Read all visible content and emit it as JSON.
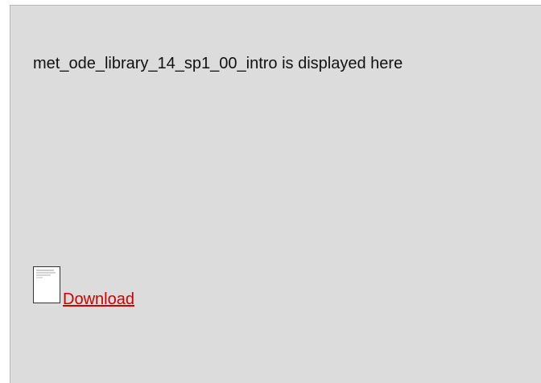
{
  "viewer": {
    "message": "met_ode_library_14_sp1_00_intro is displayed here",
    "download_label": "Download",
    "file_icon": "document-icon"
  },
  "colors": {
    "panel_background": "#dcdcdc",
    "link": "#cc0000"
  }
}
